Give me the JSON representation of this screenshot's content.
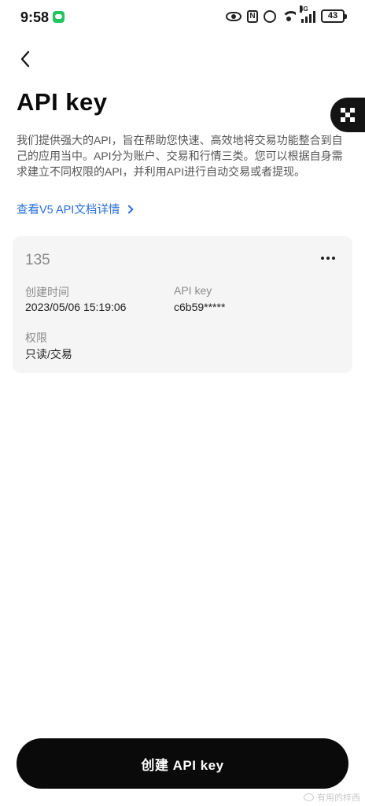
{
  "status_bar": {
    "time": "9:58",
    "nfc_glyph": "N",
    "network_label": "4G",
    "battery": "43",
    "icons": [
      "wechat-icon",
      "eye-icon",
      "nfc-icon",
      "alarm-icon",
      "wifi-icon",
      "signal-icon",
      "battery-icon"
    ]
  },
  "header": {
    "back_icon": "chevron-left-icon",
    "title": "API key",
    "floating_icon": "qr-icon"
  },
  "intro": {
    "text": "我们提供强大的API，旨在帮助您快速、高效地将交易功能整合到自己的应用当中。API分为账户、交易和行情三类。您可以根据自身需求建立不同权限的API，并利用API进行自动交易或者提现。"
  },
  "doc_link": {
    "label": "查看V5 API文档详情"
  },
  "key_card": {
    "name": "135",
    "more_icon": "more-horizontal-icon",
    "created_label": "创建时间",
    "created_value": "2023/05/06 15:19:06",
    "apikey_label": "API key",
    "apikey_value": "c6b59*****",
    "permission_label": "权限",
    "permission_value": "只读/交易"
  },
  "footer": {
    "create_button": "创建 API key"
  },
  "watermark": {
    "text": "有用的梓西"
  },
  "colors": {
    "link": "#2a6fdb",
    "primary_button": "#0a0a0a",
    "card_bg": "#f5f5f5",
    "muted_text": "#8a8a8a"
  }
}
